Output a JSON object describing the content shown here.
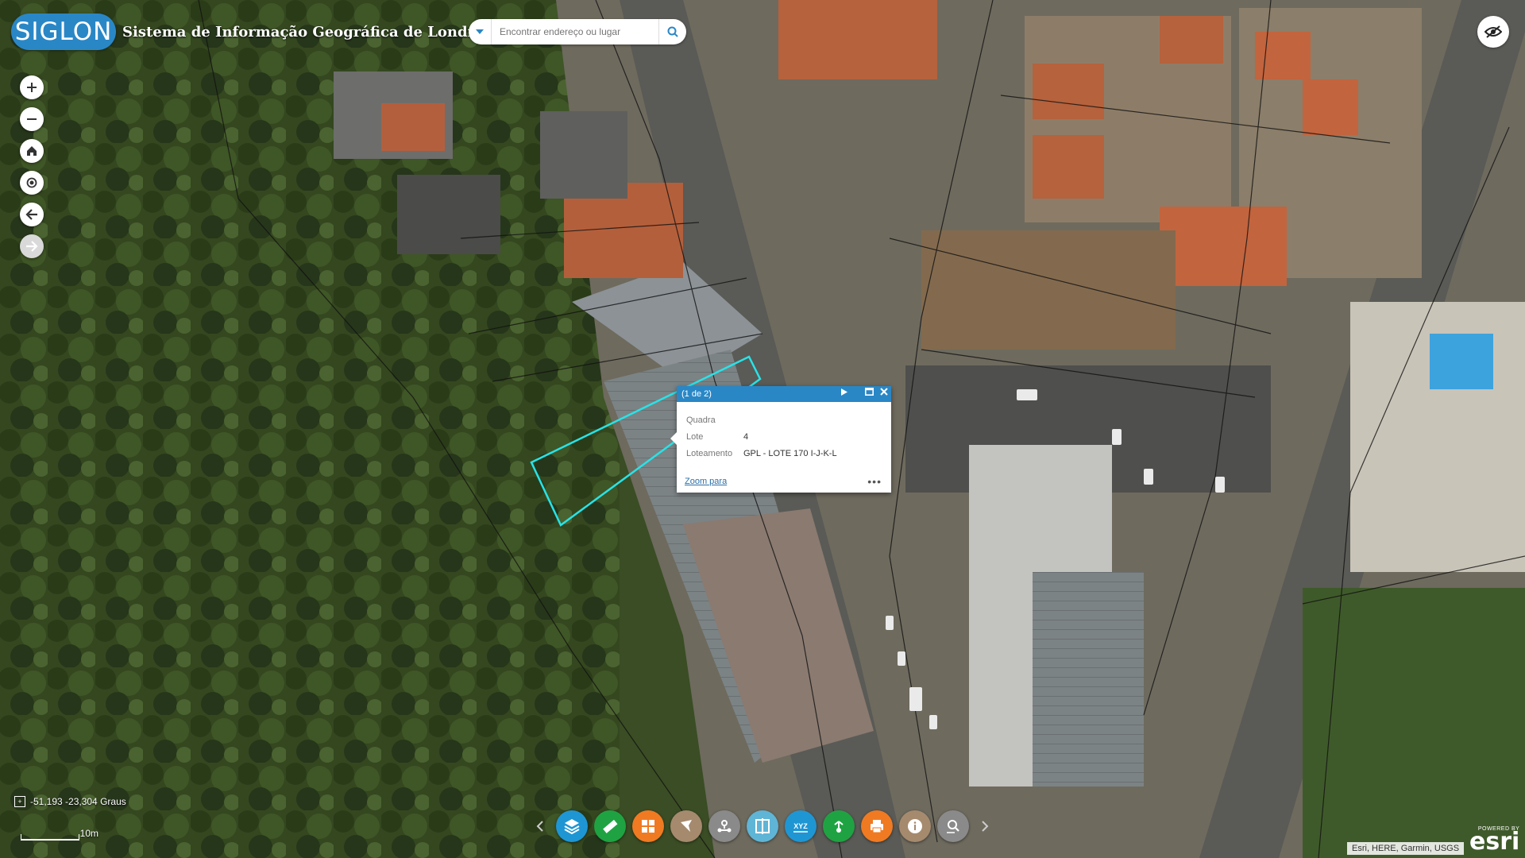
{
  "header": {
    "logo_text": "SIGLON",
    "title": "Sistema de Informação Geográfica de Londrina",
    "search_placeholder": "Encontrar endereço ou lugar"
  },
  "nav_buttons": [
    {
      "name": "zoom-in-button",
      "icon": "plus-icon"
    },
    {
      "name": "zoom-out-button",
      "icon": "minus-icon"
    },
    {
      "name": "home-button",
      "icon": "home-icon"
    },
    {
      "name": "locate-button",
      "icon": "locate-icon"
    },
    {
      "name": "previous-extent-button",
      "icon": "arrow-left-icon"
    },
    {
      "name": "next-extent-button",
      "icon": "arrow-right-icon",
      "disabled": true
    }
  ],
  "popup": {
    "counter": "(1 de 2)",
    "fields": [
      {
        "label": "Quadra",
        "value": ""
      },
      {
        "label": "Lote",
        "value": "4"
      },
      {
        "label": "Loteamento",
        "value": "GPL - LOTE 170 I-J-K-L"
      }
    ],
    "zoom_link": "Zoom para",
    "more": "•••"
  },
  "coordinates": "-51,193 -23,304 Graus",
  "scale_label": "10m",
  "toolbar": [
    {
      "name": "layers-button",
      "icon": "layers-icon",
      "color": "#1f96d4"
    },
    {
      "name": "measure-button",
      "icon": "ruler-icon",
      "color": "#1fa342"
    },
    {
      "name": "basemap-button",
      "icon": "grid-icon",
      "color": "#f07a22"
    },
    {
      "name": "filter-button",
      "icon": "flag-icon",
      "color": "#a58a6e"
    },
    {
      "name": "share-button",
      "icon": "network-icon",
      "color": "#8a8a8a"
    },
    {
      "name": "swipe-button",
      "icon": "swipe-icon",
      "color": "#5fb5d6"
    },
    {
      "name": "xyz-button",
      "icon": "xyz-icon",
      "color": "#1f96d4"
    },
    {
      "name": "route-button",
      "icon": "route-icon",
      "color": "#1fa342"
    },
    {
      "name": "print-button",
      "icon": "print-icon",
      "color": "#f07a22"
    },
    {
      "name": "info-button",
      "icon": "info-icon",
      "color": "#a58a6e"
    },
    {
      "name": "search-layer-button",
      "icon": "search-layer-icon",
      "color": "#8a8a8a"
    }
  ],
  "attribution": "Esri, HERE, Garmin, USGS",
  "esri": {
    "powered_by": "POWERED BY",
    "name": "esri"
  },
  "colors": {
    "accent": "#2a87c6",
    "selection": "#27e3e8"
  }
}
